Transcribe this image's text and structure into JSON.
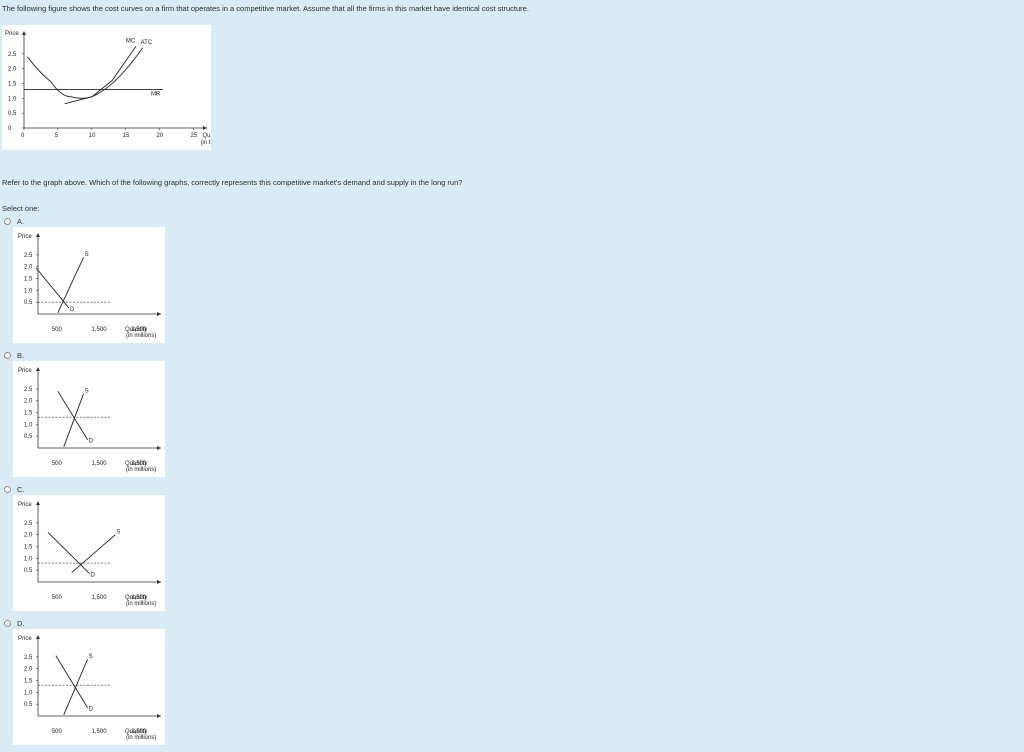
{
  "question": {
    "intro": "The following figure shows the cost curves on a firm that operates in a competitive market. Assume that all the firms in this market have identical cost structure.",
    "prompt": "Refer to the graph above. Which of the following graphs, correctly represents this competitive market's demand and supply in the long run?",
    "select_label": "Select one:"
  },
  "chart_data": [
    {
      "id": "firm",
      "type": "line",
      "ylabel": "Price",
      "xlabel": "Quantity",
      "xlabel2": "(in thousands)",
      "x_ticks": [
        "0",
        "5",
        "10",
        "15",
        "20",
        "25"
      ],
      "y_ticks": [
        "0",
        "0.5",
        "1.0",
        "1.5",
        "2.0",
        "2.5"
      ],
      "xlim": [
        0,
        27
      ],
      "ylim": [
        0,
        3.0
      ],
      "series": [
        {
          "name": "MC",
          "points": [
            [
              6,
              0.82
            ],
            [
              10,
              1.05
            ],
            [
              13,
              1.6
            ],
            [
              16.5,
              2.75
            ]
          ]
        },
        {
          "name": "ATC",
          "points": [
            [
              0.5,
              2.4
            ],
            [
              4,
              1.55
            ],
            [
              7,
              1.05
            ],
            [
              10,
              1.05
            ],
            [
              13.5,
              1.6
            ],
            [
              17.5,
              2.7
            ]
          ]
        },
        {
          "name": "MR",
          "points": [
            [
              0,
              1.3
            ],
            [
              20.5,
              1.3
            ]
          ]
        }
      ]
    },
    {
      "id": "A",
      "type": "line",
      "ylabel": "Price",
      "xlabel": "Quantity",
      "xlabel2": "(in millions)",
      "x_ticks": [
        "500",
        "1,500",
        "2,500"
      ],
      "x_tick_vals": [
        500,
        1500,
        2500
      ],
      "y_ticks": [
        "0.5",
        "1.0",
        "1.5",
        "2.0",
        "2.5"
      ],
      "xlim": [
        0,
        3100
      ],
      "ylim": [
        0,
        3.0
      ],
      "demand": {
        "label": "D",
        "points": [
          [
            -50,
            1.95
          ],
          [
            780,
            0.25
          ]
        ]
      },
      "supply": {
        "label": "S",
        "points": [
          [
            500,
            0.05
          ],
          [
            1150,
            2.4
          ]
        ]
      },
      "price_line": 0.5
    },
    {
      "id": "B",
      "type": "line",
      "ylabel": "Price",
      "xlabel": "Quantity",
      "xlabel2": "(in millions)",
      "x_ticks": [
        "500",
        "1,500",
        "2,500"
      ],
      "x_tick_vals": [
        500,
        1500,
        2500
      ],
      "y_ticks": [
        "0.5",
        "1.0",
        "1.5",
        "2.0",
        "2.5"
      ],
      "xlim": [
        0,
        3100
      ],
      "ylim": [
        0,
        3.0
      ],
      "demand": {
        "label": "D",
        "points": [
          [
            500,
            2.4
          ],
          [
            1250,
            0.35
          ]
        ]
      },
      "supply": {
        "label": "S",
        "points": [
          [
            650,
            0.05
          ],
          [
            1150,
            2.3
          ]
        ]
      },
      "price_line": 1.3
    },
    {
      "id": "C",
      "type": "line",
      "ylabel": "Price",
      "xlabel": "Quantity",
      "xlabel2": "(in millions)",
      "x_ticks": [
        "500",
        "1,500",
        "2,500"
      ],
      "x_tick_vals": [
        500,
        1500,
        2500
      ],
      "y_ticks": [
        "0.5",
        "1.0",
        "1.5",
        "2.0",
        "2.5"
      ],
      "xlim": [
        0,
        3100
      ],
      "ylim": [
        0,
        3.0
      ],
      "demand": {
        "label": "D",
        "points": [
          [
            250,
            2.1
          ],
          [
            1300,
            0.35
          ]
        ]
      },
      "supply": {
        "label": "S",
        "points": [
          [
            850,
            0.4
          ],
          [
            1950,
            2.0
          ]
        ]
      },
      "price_line": 0.8
    },
    {
      "id": "D",
      "type": "line",
      "ylabel": "Price",
      "xlabel": "Quantity",
      "xlabel2": "(in millions)",
      "x_ticks": [
        "500",
        "1,500",
        "2,500"
      ],
      "x_tick_vals": [
        500,
        1500,
        2500
      ],
      "y_ticks": [
        "0.5",
        "1.0",
        "1.5",
        "2.0",
        "2.5"
      ],
      "xlim": [
        0,
        3100
      ],
      "ylim": [
        0,
        3.0
      ],
      "demand": {
        "label": "D",
        "points": [
          [
            450,
            2.55
          ],
          [
            1250,
            0.35
          ]
        ]
      },
      "supply": {
        "label": "S",
        "points": [
          [
            650,
            0.05
          ],
          [
            1250,
            2.4
          ]
        ]
      },
      "price_line": 1.3
    }
  ],
  "options": [
    {
      "label": "A."
    },
    {
      "label": "B."
    },
    {
      "label": "C."
    },
    {
      "label": "D."
    }
  ]
}
